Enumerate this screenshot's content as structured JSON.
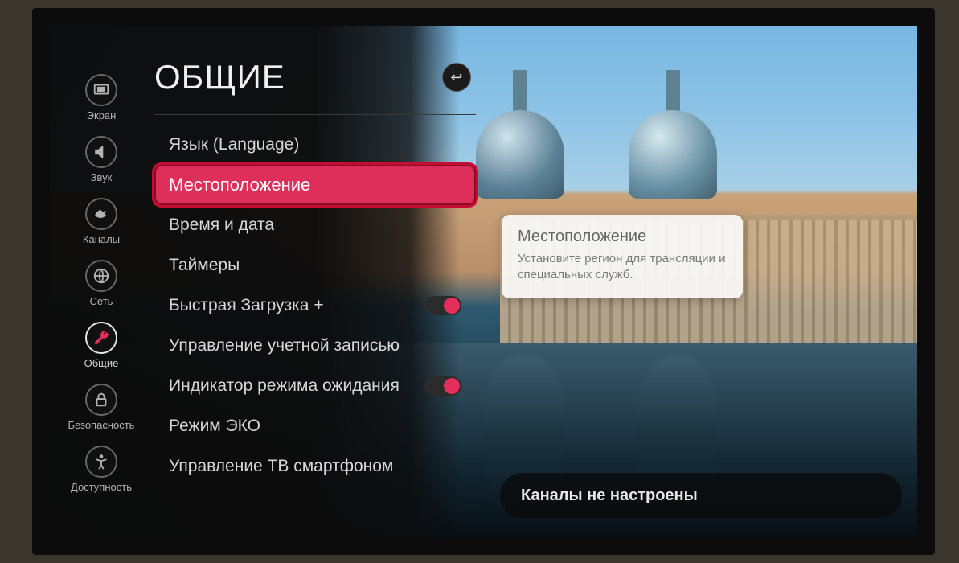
{
  "page": {
    "title": "ОБЩИЕ"
  },
  "sidebar": {
    "items": [
      {
        "id": "screen",
        "label": "Экран"
      },
      {
        "id": "sound",
        "label": "Звук"
      },
      {
        "id": "channels",
        "label": "Каналы"
      },
      {
        "id": "network",
        "label": "Сеть"
      },
      {
        "id": "general",
        "label": "Общие"
      },
      {
        "id": "security",
        "label": "Безопасность"
      },
      {
        "id": "accessibility",
        "label": "Доступность"
      }
    ],
    "active": "general"
  },
  "menu": {
    "items": [
      {
        "id": "language",
        "label": "Язык (Language)"
      },
      {
        "id": "location",
        "label": "Местоположение",
        "selected": true
      },
      {
        "id": "datetime",
        "label": "Время и дата"
      },
      {
        "id": "timers",
        "label": "Таймеры"
      },
      {
        "id": "quickstart",
        "label": "Быстрая Загрузка +",
        "toggle": true,
        "on": true
      },
      {
        "id": "account",
        "label": "Управление учетной записью"
      },
      {
        "id": "standbyled",
        "label": "Индикатор режима ожидания",
        "toggle": true,
        "on": true
      },
      {
        "id": "eco",
        "label": "Режим ЭКО"
      },
      {
        "id": "tvphone",
        "label": "Управление ТВ смартфоном"
      }
    ]
  },
  "description": {
    "title": "Местоположение",
    "body": "Установите регион для трансляции и специальных служб."
  },
  "status": {
    "message": "Каналы не настроены"
  }
}
